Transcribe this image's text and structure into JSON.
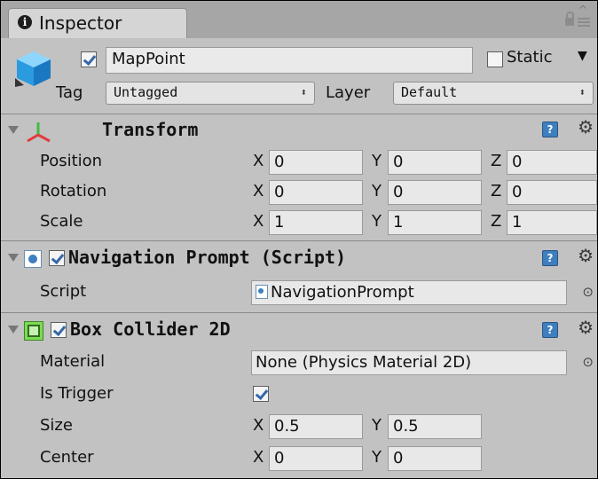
{
  "tab": {
    "title": "Inspector",
    "icon": "info-icon"
  },
  "object": {
    "name": "MapPoint",
    "active": true,
    "static_label": "Static",
    "static_checked": false,
    "tag_label": "Tag",
    "tag_value": "Untagged",
    "layer_label": "Layer",
    "layer_value": "Default"
  },
  "transform": {
    "title": "Transform",
    "rows": [
      {
        "label": "Position",
        "x": "0",
        "y": "0",
        "z": "0"
      },
      {
        "label": "Rotation",
        "x": "0",
        "y": "0",
        "z": "0"
      },
      {
        "label": "Scale",
        "x": "1",
        "y": "1",
        "z": "1"
      }
    ]
  },
  "script_comp": {
    "title": "Navigation Prompt (Script)",
    "enabled": true,
    "script_label": "Script",
    "script_value": "NavigationPrompt"
  },
  "collider": {
    "title": "Box Collider 2D",
    "enabled": true,
    "material_label": "Material",
    "material_value": "None (Physics Material 2D)",
    "trigger_label": "Is Trigger",
    "is_trigger": true,
    "size_label": "Size",
    "size_x": "0.5",
    "size_y": "0.5",
    "center_label": "Center",
    "center_x": "0",
    "center_y": "0"
  },
  "axes": {
    "x": "X",
    "y": "Y",
    "z": "Z"
  },
  "colors": {
    "panel": "#c2c2c2",
    "accent": "#3d7fbf",
    "tab_bar": "#a6a6a6"
  }
}
